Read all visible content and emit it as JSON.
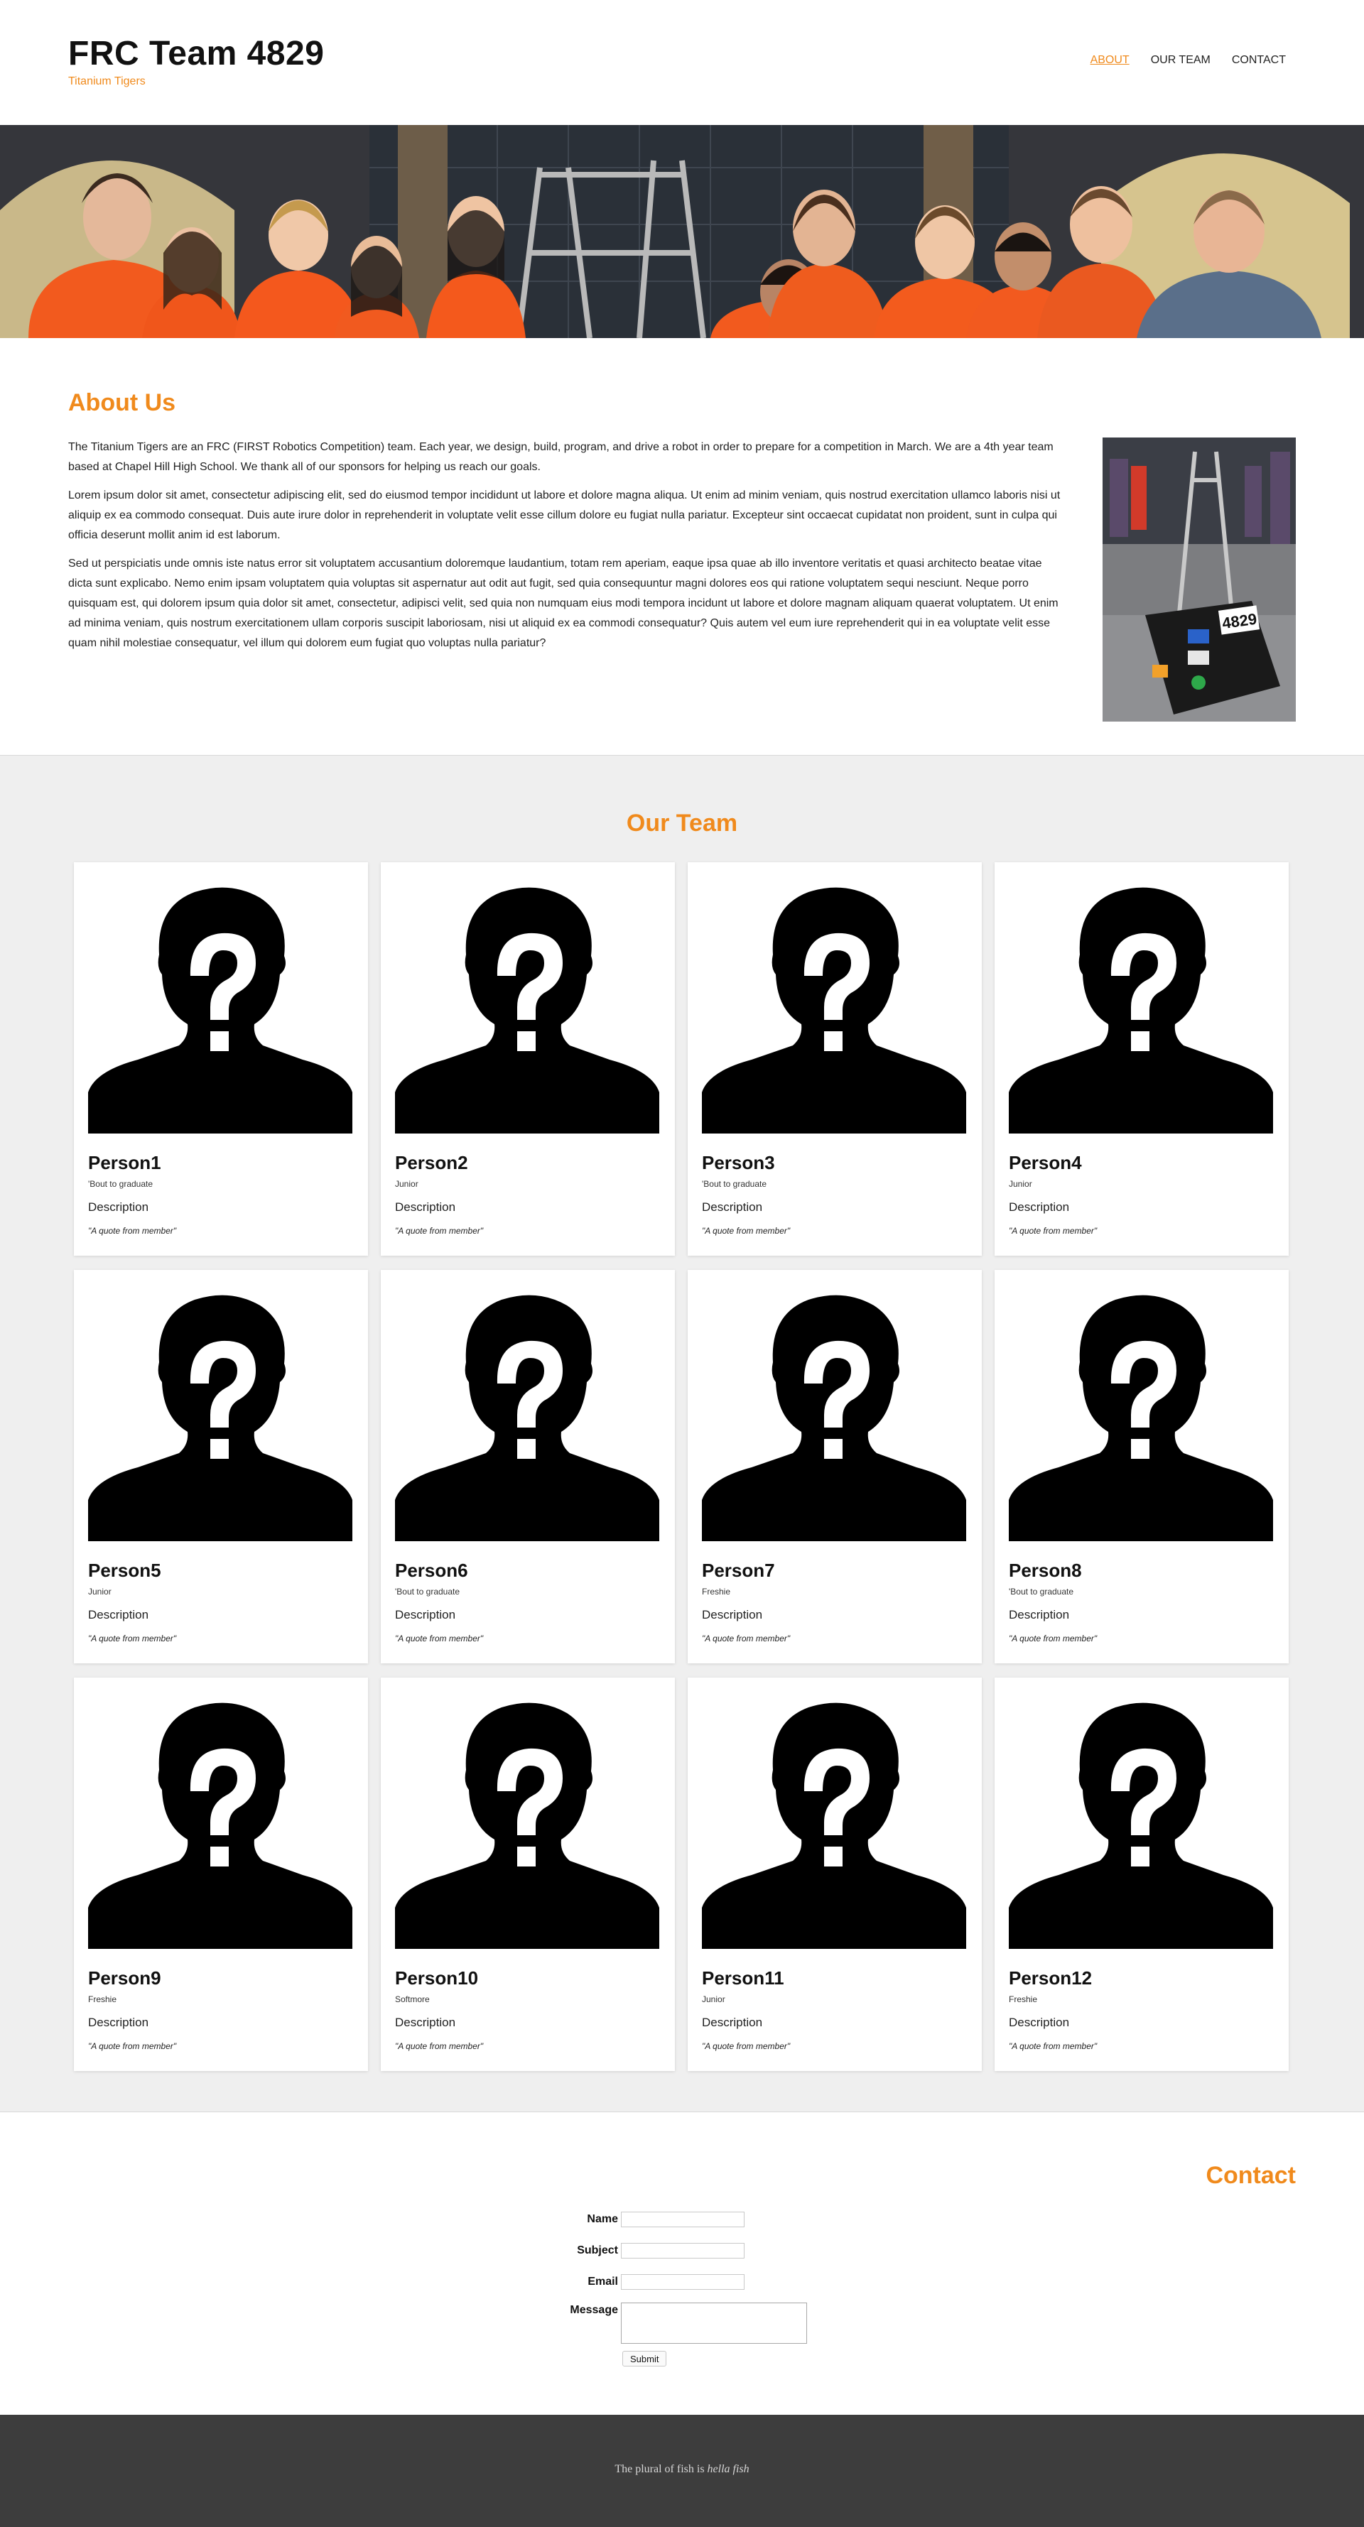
{
  "header": {
    "title": "FRC Team 4829",
    "tagline": "Titanium Tigers",
    "nav": [
      {
        "label": "ABOUT"
      },
      {
        "label": "OUR TEAM"
      },
      {
        "label": "CONTACT"
      }
    ]
  },
  "banner": {
    "image": "team-photo"
  },
  "about": {
    "heading": "About Us",
    "paragraphs": [
      "The Titanium Tigers are an FRC (FIRST Robotics Competition) team. Each year, we design, build, program, and drive a robot in order to prepare for a competition in March. We are a 4th year team based at Chapel Hill High School. We thank all of our sponsors for helping us reach our goals.",
      "Lorem ipsum dolor sit amet, consectetur adipiscing elit, sed do eiusmod tempor incididunt ut labore et dolore magna aliqua. Ut enim ad minim veniam, quis nostrud exercitation ullamco laboris nisi ut aliquip ex ea commodo consequat. Duis aute irure dolor in reprehenderit in voluptate velit esse cillum dolore eu fugiat nulla pariatur. Excepteur sint occaecat cupidatat non proident, sunt in culpa qui officia deserunt mollit anim id est laborum.",
      "Sed ut perspiciatis unde omnis iste natus error sit voluptatem accusantium doloremque laudantium, totam rem aperiam, eaque ipsa quae ab illo inventore veritatis et quasi architecto beatae vitae dicta sunt explicabo. Nemo enim ipsam voluptatem quia voluptas sit aspernatur aut odit aut fugit, sed quia consequuntur magni dolores eos qui ratione voluptatem sequi nesciunt. Neque porro quisquam est, qui dolorem ipsum quia dolor sit amet, consectetur, adipisci velit, sed quia non numquam eius modi tempora incidunt ut labore et dolore magnam aliquam quaerat voluptatem. Ut enim ad minima veniam, quis nostrum exercitationem ullam corporis suscipit laboriosam, nisi ut aliquid ex ea commodi consequatur? Quis autem vel eum iure reprehenderit qui in ea voluptate velit esse quam nihil molestiae consequatur, vel illum qui dolorem eum fugiat quo voluptas nulla pariatur?"
    ],
    "photo": {
      "image": "robot-photo",
      "robot_number": "4829"
    }
  },
  "team": {
    "heading": "Our Team",
    "placeholder_icon": "unknown-person-icon",
    "members": [
      {
        "name": "Person1",
        "grade": "'Bout to graduate",
        "description": "Description",
        "quote": "\"A quote from member\""
      },
      {
        "name": "Person2",
        "grade": "Junior",
        "description": "Description",
        "quote": "\"A quote from member\""
      },
      {
        "name": "Person3",
        "grade": "'Bout to graduate",
        "description": "Description",
        "quote": "\"A quote from member\""
      },
      {
        "name": "Person4",
        "grade": "Junior",
        "description": "Description",
        "quote": "\"A quote from member\""
      },
      {
        "name": "Person5",
        "grade": "Junior",
        "description": "Description",
        "quote": "\"A quote from member\""
      },
      {
        "name": "Person6",
        "grade": "'Bout to graduate",
        "description": "Description",
        "quote": "\"A quote from member\""
      },
      {
        "name": "Person7",
        "grade": "Freshie",
        "description": "Description",
        "quote": "\"A quote from member\""
      },
      {
        "name": "Person8",
        "grade": "'Bout to graduate",
        "description": "Description",
        "quote": "\"A quote from member\""
      },
      {
        "name": "Person9",
        "grade": "Freshie",
        "description": "Description",
        "quote": "\"A quote from member\""
      },
      {
        "name": "Person10",
        "grade": "Softmore",
        "description": "Description",
        "quote": "\"A quote from member\""
      },
      {
        "name": "Person11",
        "grade": "Junior",
        "description": "Description",
        "quote": "\"A quote from member\""
      },
      {
        "name": "Person12",
        "grade": "Freshie",
        "description": "Description",
        "quote": "\"A quote from member\""
      }
    ]
  },
  "contact": {
    "heading": "Contact",
    "fields": [
      {
        "label": "Name",
        "value": ""
      },
      {
        "label": "Subject",
        "value": ""
      },
      {
        "label": "Email",
        "value": ""
      },
      {
        "label": "Message",
        "value": ""
      }
    ],
    "submit_label": "Submit"
  },
  "footer": {
    "text_prefix": "The plural of fish is",
    "text_emphasis": "hella fish"
  },
  "colors": {
    "accent": "#f08a1c",
    "page_background": "#ffffff",
    "team_background": "#efefef",
    "footer_background": "#3d3d3d"
  }
}
